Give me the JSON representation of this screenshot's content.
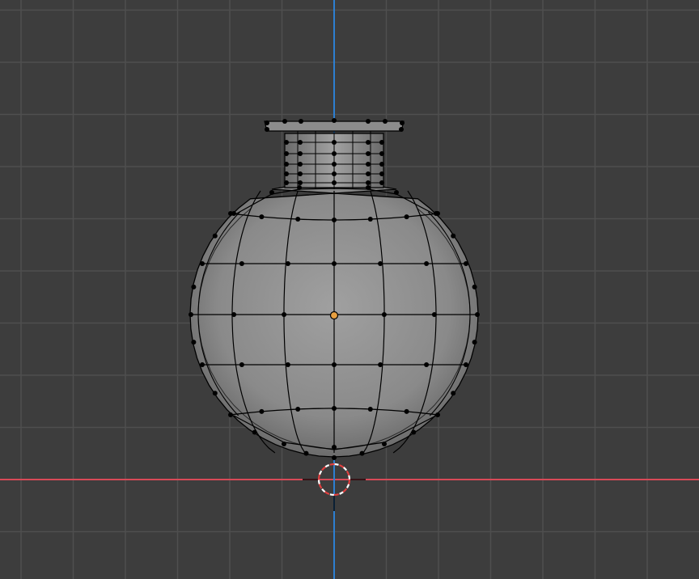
{
  "viewport": {
    "view": "front-orthographic",
    "mode": "edit-mode",
    "selection": "vertex",
    "object": "flask-mesh"
  },
  "colors": {
    "background": "#3d3d3d",
    "grid_line": "#4f4f4f",
    "axis_x": "#d84a57",
    "axis_z": "#2d7fd1",
    "mesh_fill_light": "#9b9b9b",
    "mesh_fill_dark": "#505050",
    "wire": "#000000",
    "vertex": "#000000",
    "origin": "#e8a040",
    "cursor_red": "#ffffff",
    "cursor_white": "#e0e0e0"
  },
  "icons": {
    "cursor": "3d-cursor-icon",
    "origin": "object-origin-icon"
  }
}
